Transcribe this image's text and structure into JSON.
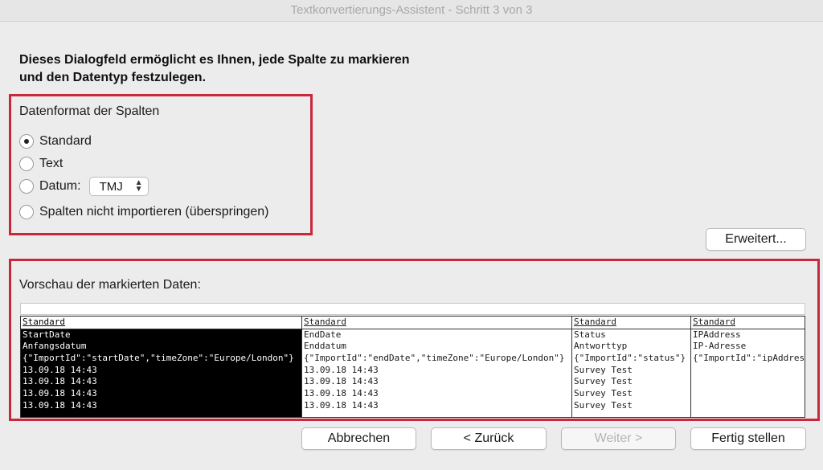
{
  "window": {
    "title": "Textkonvertierungs-Assistent - Schritt 3 von 3"
  },
  "instructions": {
    "line1": "Dieses Dialogfeld ermöglicht es Ihnen, jede Spalte zu markieren",
    "line2": "und den Datentyp festzulegen."
  },
  "format": {
    "title": "Datenformat der Spalten",
    "options": [
      {
        "label": "Standard",
        "checked": true
      },
      {
        "label": "Text",
        "checked": false
      },
      {
        "label": "Datum:",
        "checked": false
      },
      {
        "label": "Spalten nicht importieren (überspringen)",
        "checked": false
      }
    ],
    "date_select": {
      "value": "TMJ"
    }
  },
  "advanced_button": "Erweitert...",
  "preview": {
    "title": "Vorschau der markierten Daten:",
    "columns": [
      {
        "header": "Standard",
        "selected": true,
        "cells": [
          "StartDate",
          "Anfangsdatum",
          "{\"ImportId\":\"startDate\",\"timeZone\":\"Europe/London\"}",
          "13.09.18 14:43",
          "13.09.18 14:43",
          "13.09.18 14:43",
          "13.09.18 14:43"
        ]
      },
      {
        "header": "Standard",
        "selected": false,
        "cells": [
          "EndDate",
          "Enddatum",
          "{\"ImportId\":\"endDate\",\"timeZone\":\"Europe/London\"}",
          "13.09.18 14:43",
          "13.09.18 14:43",
          "13.09.18 14:43",
          "13.09.18 14:43"
        ]
      },
      {
        "header": "Standard",
        "selected": false,
        "cells": [
          "Status",
          "Antworttyp",
          "{\"ImportId\":\"status\"}",
          "Survey Test",
          "Survey Test",
          "Survey Test",
          "Survey Test"
        ]
      },
      {
        "header": "Standard",
        "selected": false,
        "cells": [
          "IPAddress",
          "IP-Adresse",
          "{\"ImportId\":\"ipAddress\"}",
          "",
          "",
          "",
          ""
        ]
      }
    ]
  },
  "buttons": {
    "cancel": "Abbrechen",
    "back": "< Zurück",
    "next": "Weiter >",
    "finish": "Fertig stellen"
  },
  "colors": {
    "highlight": "#c8283c",
    "selected_column": "#000000"
  }
}
